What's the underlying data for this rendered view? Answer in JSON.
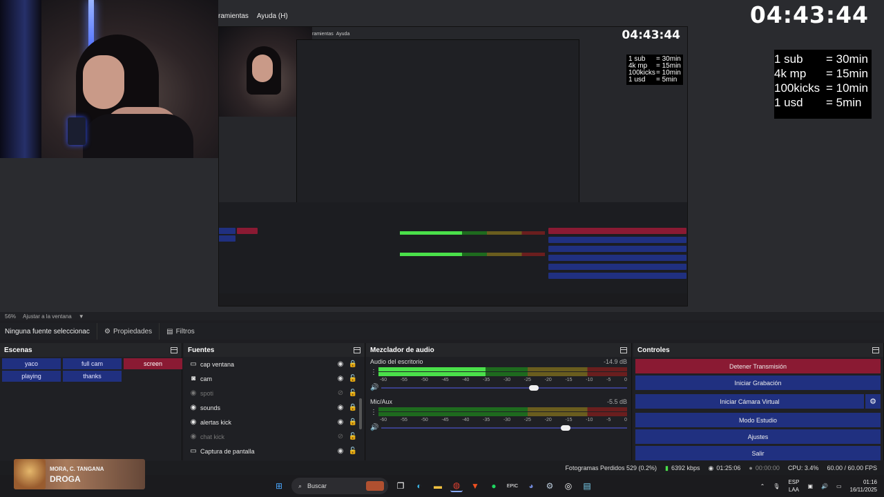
{
  "window_menu": {
    "tools": "ramientas",
    "help": "Ayuda (H)"
  },
  "stream_timer": "04:43:44",
  "rates": [
    {
      "k": "1 sub",
      "v": "= 30min"
    },
    {
      "k": "4k mp",
      "v": "= 15min"
    },
    {
      "k": "100kicks",
      "v": "= 10min"
    },
    {
      "k": "1 usd",
      "v": "=  5min"
    }
  ],
  "zoom": {
    "percent": "56%",
    "label": "Ajustar a la ventana"
  },
  "propbar": {
    "no_source": "Ninguna fuente seleccionac",
    "properties": "Propiedades",
    "filters": "Filtros"
  },
  "scenes": {
    "title": "Escenas",
    "items": [
      {
        "label": "yaco",
        "active": false
      },
      {
        "label": "full cam",
        "active": false
      },
      {
        "label": "screen",
        "active": true
      },
      {
        "label": "playing",
        "active": false
      },
      {
        "label": "thanks",
        "active": false
      }
    ]
  },
  "sources": {
    "title": "Fuentes",
    "items": [
      {
        "label": "cap ventana",
        "icon": "window-icon",
        "glyph": "▭",
        "visible": true,
        "locked": true
      },
      {
        "label": "cam",
        "icon": "camera-icon",
        "glyph": "◙",
        "visible": true,
        "locked": false
      },
      {
        "label": "spoti",
        "icon": "media-icon",
        "glyph": "◉",
        "visible": false,
        "locked": false
      },
      {
        "label": "sounds",
        "icon": "media-icon",
        "glyph": "◉",
        "visible": true,
        "locked": true
      },
      {
        "label": "alertas kick",
        "icon": "media-icon",
        "glyph": "◉",
        "visible": true,
        "locked": true
      },
      {
        "label": "chat kick",
        "icon": "browser-icon",
        "glyph": "◉",
        "visible": false,
        "locked": false
      },
      {
        "label": "Captura de pantalla",
        "icon": "monitor-icon",
        "glyph": "▭",
        "visible": true,
        "locked": false
      }
    ]
  },
  "mixer": {
    "title": "Mezclador de audio",
    "ticks": [
      "-60",
      "-55",
      "-50",
      "-45",
      "-40",
      "-35",
      "-30",
      "-25",
      "-20",
      "-15",
      "-10",
      "-5",
      "0"
    ],
    "channels": [
      {
        "name": "Audio del escritorio",
        "db": "-14.9 dB",
        "level": 0.43,
        "volume": 0.62
      },
      {
        "name": "Mic/Aux",
        "db": "-5.5 dB",
        "level": 0.0,
        "volume": 0.75
      }
    ]
  },
  "controls": {
    "title": "Controles",
    "stop_stream": "Detener Transmisión",
    "start_recording": "Iniciar Grabación",
    "start_virtualcam": "Iniciar Cámara Virtual",
    "studio_mode": "Modo Estudio",
    "settings": "Ajustes",
    "exit": "Salir"
  },
  "status": {
    "dropped": "Fotogramas Perdidos 529 (0.2%)",
    "bitrate": "6392 kbps",
    "stream_time": "01:25:06",
    "rec_time": "00:00:00",
    "cpu": "CPU: 3.4%",
    "fps": "60.00 / 60.00 FPS"
  },
  "taskbar": {
    "search": "Buscar",
    "lang_top": "ESP",
    "lang_bottom": "LAA",
    "time": "01:16",
    "date": "16/11/2025"
  },
  "now_playing": {
    "artist": "MORA, C. TANGANA",
    "song": "DROGA"
  },
  "colors": {
    "scene_active": "#8a1a33",
    "button_blue": "#203080",
    "meter_green": "#4ae04a"
  }
}
